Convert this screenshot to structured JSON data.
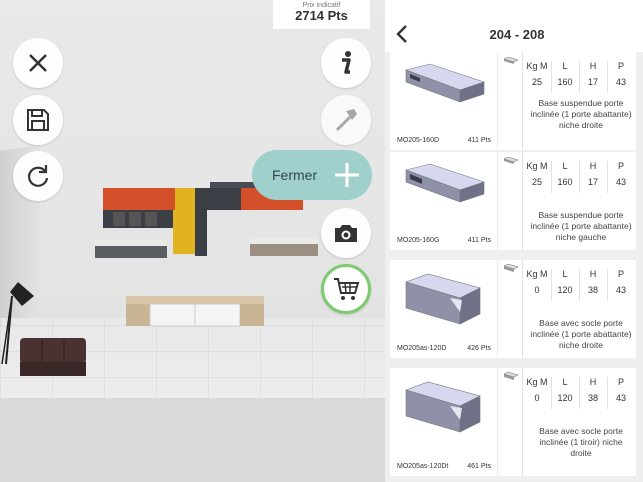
{
  "header": {
    "price_label": "Prix indicatif",
    "price_value": "2714 Pts"
  },
  "scene_controls": {
    "fermer_label": "Fermer",
    "buttons": [
      "close-icon",
      "save-icon",
      "refresh-icon",
      "info-icon",
      "hammer-icon",
      "camera-icon",
      "cart-icon"
    ]
  },
  "panel": {
    "title": "204 - 208",
    "dim_headers": [
      "Kg M",
      "L",
      "H",
      "P"
    ],
    "products": [
      {
        "ref": "MO205-160D",
        "pts": "411 Pts",
        "kg": "25",
        "l": "160",
        "h": "17",
        "p": "43",
        "desc": "Base suspendue porte inclinée (1 porte abattante) niche droite"
      },
      {
        "ref": "MO205-160G",
        "pts": "411 Pts",
        "kg": "25",
        "l": "160",
        "h": "17",
        "p": "43",
        "desc": "Base suspendue porte inclinée (1 porte abattante) niche gauche"
      },
      {
        "ref": "MO205as-120D",
        "pts": "426 Pts",
        "kg": "0",
        "l": "120",
        "h": "38",
        "p": "43",
        "desc": "Base avec socle porte inclinée (1 porte abattante) niche droite"
      },
      {
        "ref": "MO205as-120Dt",
        "pts": "461 Pts",
        "kg": "0",
        "l": "120",
        "h": "38",
        "p": "43",
        "desc": "Base avec socle porte inclinée (1 tiroir) niche droite"
      }
    ]
  },
  "colors": {
    "accent": "#9fd0cc",
    "cart_ring": "#7ccc6f",
    "shelf_orange": "#d4502a",
    "shelf_yellow": "#e2b321",
    "shelf_dark": "#3b3e45"
  }
}
